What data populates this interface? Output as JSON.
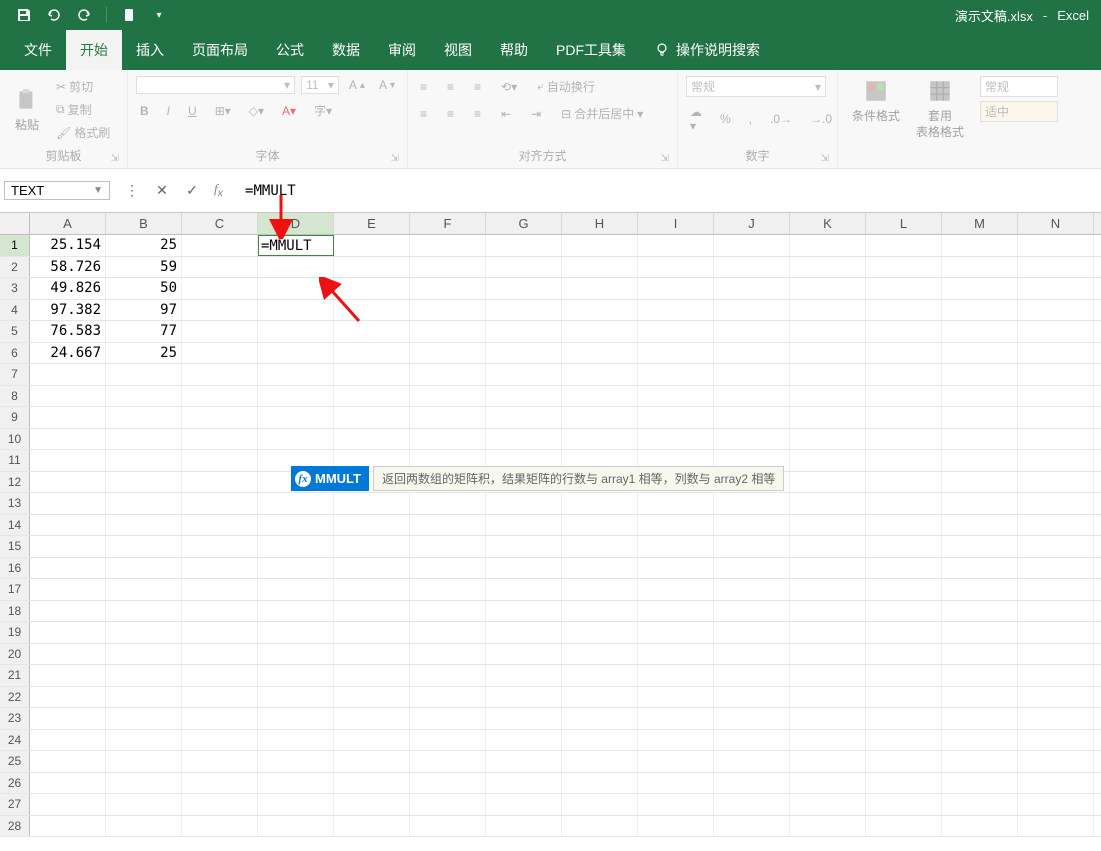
{
  "title": {
    "doc": "演示文稿.xlsx",
    "sep": "-",
    "app": "Excel"
  },
  "tabs": {
    "file": "文件",
    "home": "开始",
    "insert": "插入",
    "layout": "页面布局",
    "formula": "公式",
    "data": "数据",
    "review": "审阅",
    "view": "视图",
    "help": "帮助",
    "pdf": "PDF工具集",
    "tellme": "操作说明搜索"
  },
  "ribbon": {
    "clipboard": {
      "paste": "粘贴",
      "cut": "剪切",
      "copy": "复制",
      "painter": "格式刷",
      "label": "剪贴板"
    },
    "font": {
      "name": "",
      "size": "11",
      "bold": "B",
      "italic": "I",
      "underline": "U",
      "label": "字体"
    },
    "align": {
      "wrap": "自动换行",
      "merge": "合并后居中",
      "label": "对齐方式"
    },
    "number": {
      "format": "常规",
      "label": "数字"
    },
    "styles": {
      "cond": "条件格式",
      "table": "套用",
      "table2": "表格格式",
      "general": "常规",
      "neutral": "适中"
    }
  },
  "fxbar": {
    "namebox": "TEXT",
    "formula": "=MMULT"
  },
  "grid": {
    "cols": [
      "A",
      "B",
      "C",
      "D",
      "E",
      "F",
      "G",
      "H",
      "I",
      "J",
      "K",
      "L",
      "M",
      "N"
    ],
    "rows": 28,
    "data": [
      {
        "A": "25.154",
        "B": "25",
        "D": "=MMULT"
      },
      {
        "A": "58.726",
        "B": "59"
      },
      {
        "A": "49.826",
        "B": "50"
      },
      {
        "A": "97.382",
        "B": "97"
      },
      {
        "A": "76.583",
        "B": "77"
      },
      {
        "A": "24.667",
        "B": "25"
      }
    ],
    "edit_cell": {
      "row": 0,
      "col": "D"
    }
  },
  "autocomplete": {
    "name": "MMULT",
    "desc": "返回两数组的矩阵积，结果矩阵的行数与 array1 相等，列数与 array2 相等"
  }
}
